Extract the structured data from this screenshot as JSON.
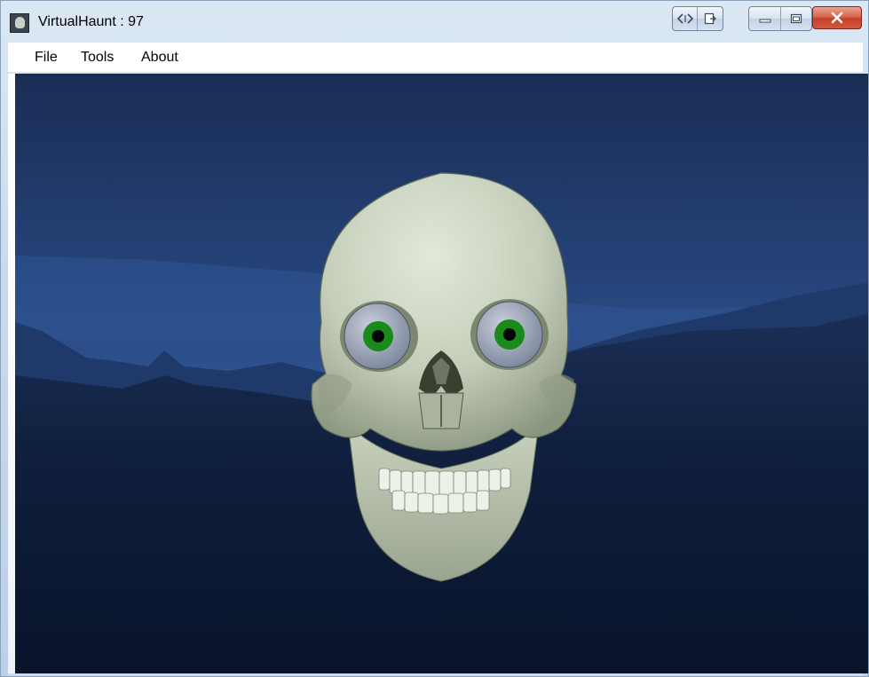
{
  "window": {
    "title": "VirtualHaunt : 97"
  },
  "menu": {
    "items": [
      "File",
      "Tools",
      "About"
    ]
  },
  "icons": {
    "app": "skull-app-icon",
    "caption_extra_1": "code-brackets-icon",
    "caption_extra_2": "dock-window-icon",
    "minimize": "minimize-icon",
    "maximize": "maximize-icon",
    "close": "close-icon"
  },
  "colors": {
    "sky_top": "#1a2f58",
    "sky_horizon": "#2d4f88",
    "ground": "#0c1a33",
    "skull": "#c8d0bd",
    "iris": "#1a8a1a",
    "close_button": "#c9452e"
  }
}
